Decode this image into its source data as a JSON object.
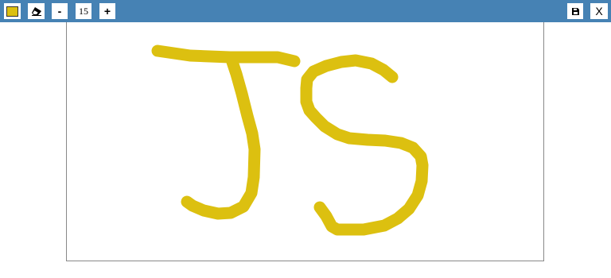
{
  "toolbar": {
    "brush_color": "#dcc010",
    "color_icon": "color-swatch-icon",
    "eraser_icon": "eraser-icon",
    "decrease_label": "-",
    "brush_size": "15",
    "increase_label": "+",
    "save_icon": "save-icon",
    "close_label": "X",
    "bar_color": "#4682b4"
  },
  "canvas": {
    "stroke_color": "#dcc010",
    "background": "#ffffff"
  }
}
